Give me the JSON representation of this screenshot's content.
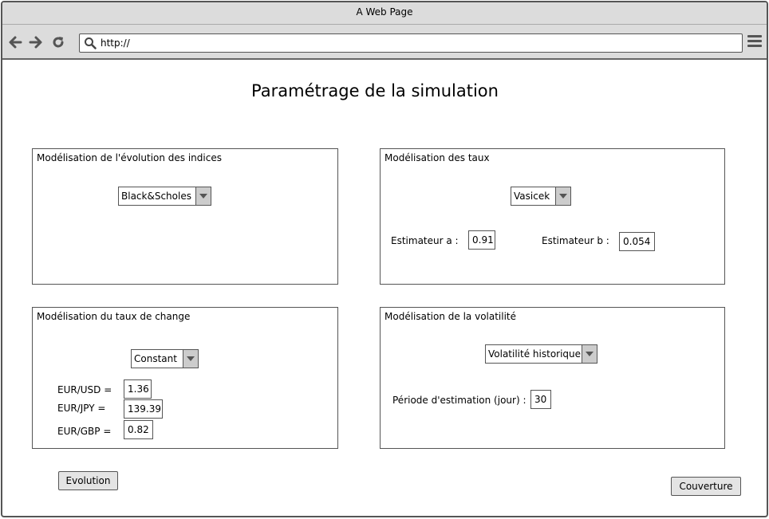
{
  "window": {
    "title": "A Web Page"
  },
  "browser": {
    "url": "http://"
  },
  "page": {
    "title": "Paramétrage de la simulation"
  },
  "panels": {
    "indices": {
      "title": "Modélisation de l'évolution des indices",
      "model": "Black&Scholes"
    },
    "taux": {
      "title": "Modélisation des taux",
      "model": "Vasicek",
      "estimateur_a_label": "Estimateur a :",
      "estimateur_a_value": "0.91",
      "estimateur_b_label": "Estimateur b :",
      "estimateur_b_value": "0.054"
    },
    "change": {
      "title": "Modélisation du taux de change",
      "model": "Constant",
      "rates": [
        {
          "label": "EUR/USD =",
          "value": "1.36"
        },
        {
          "label": "EUR/JPY =",
          "value": "139.39"
        },
        {
          "label": "EUR/GBP =",
          "value": "0.82"
        }
      ]
    },
    "volatilite": {
      "title": "Modélisation de la volatilité",
      "model": "Volatilité historique",
      "periode_label": "Période d'estimation (jour) :",
      "periode_value": "30"
    }
  },
  "buttons": {
    "evolution": "Evolution",
    "couverture": "Couverture"
  },
  "icons": {
    "back": "arrow-left-icon",
    "forward": "arrow-right-icon",
    "reload": "reload-icon",
    "search": "search-icon",
    "menu": "hamburger-menu-icon",
    "dropdown": "chevron-down-icon"
  }
}
